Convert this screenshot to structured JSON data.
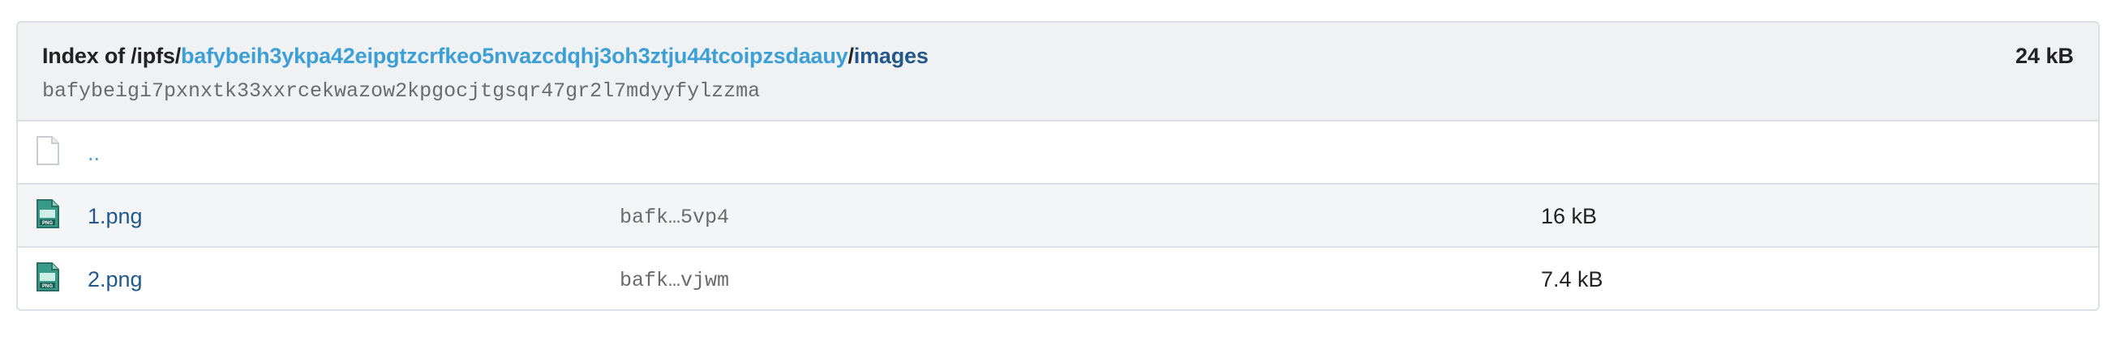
{
  "header": {
    "prefix": "Index of /ipfs/",
    "root_cid": "bafybeih3ykpa42eipgtzcrfkeo5nvazcdqhj3oh3ztju44tcoipzsdaauy",
    "separator": "/",
    "folder": "images",
    "total_size": "24 kB",
    "folder_cid": "bafybeigi7pxnxtk33xxrcekwazow2kpgocjtgsqr47gr2l7mdyyfylzzma"
  },
  "rows": [
    {
      "icon": "blank-file-icon",
      "name": "..",
      "hash": "",
      "size": ""
    },
    {
      "icon": "png-file-icon",
      "name": "1.png",
      "hash": "bafk…5vp4",
      "size": "16 kB"
    },
    {
      "icon": "png-file-icon",
      "name": "2.png",
      "hash": "bafk…vjwm",
      "size": "7.4 kB"
    }
  ],
  "colors": {
    "link_root": "#3ca0d6",
    "link": "#24588a",
    "header_bg": "#f0f1f3",
    "alt_row_bg": "#f4f5f6",
    "border": "#dcdfe3",
    "png_icon": "#2f8a7a"
  }
}
